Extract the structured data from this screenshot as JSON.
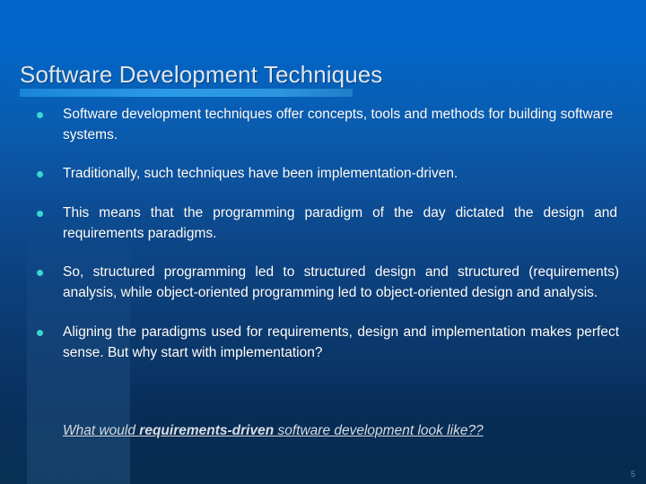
{
  "slide": {
    "title": "Software Development Techniques",
    "bullets": [
      {
        "id": "b1",
        "text": "Software development techniques offer concepts, tools and methods for building software systems."
      },
      {
        "id": "b2",
        "text": "Traditionally, such techniques have been implementation-driven."
      },
      {
        "id": "b3",
        "text": "This means that the programming paradigm of the day dictated the design and requirements paradigms."
      },
      {
        "id": "b4",
        "text": "So, structured programming led to structured design and structured (requirements) analysis, while object-oriented programming led to object-oriented design and analysis."
      },
      {
        "id": "b5",
        "text": "Aligning the paradigms used for requirements, design and implementation makes perfect sense. But why start with implementation?"
      }
    ],
    "closing": {
      "part1": "What would ",
      "emphasis": "requirements-driven",
      "part2": " software development look like?? "
    },
    "slide_number": "5",
    "colors": {
      "background_top": "#0066cc",
      "background_bottom": "#073054",
      "title_text": "#dfe6ee",
      "title_rule": "#2b9ae6",
      "bullet_dot": "#3ad6cf",
      "body_text": "#ffffff",
      "closing_text": "#d8dfe8"
    }
  }
}
